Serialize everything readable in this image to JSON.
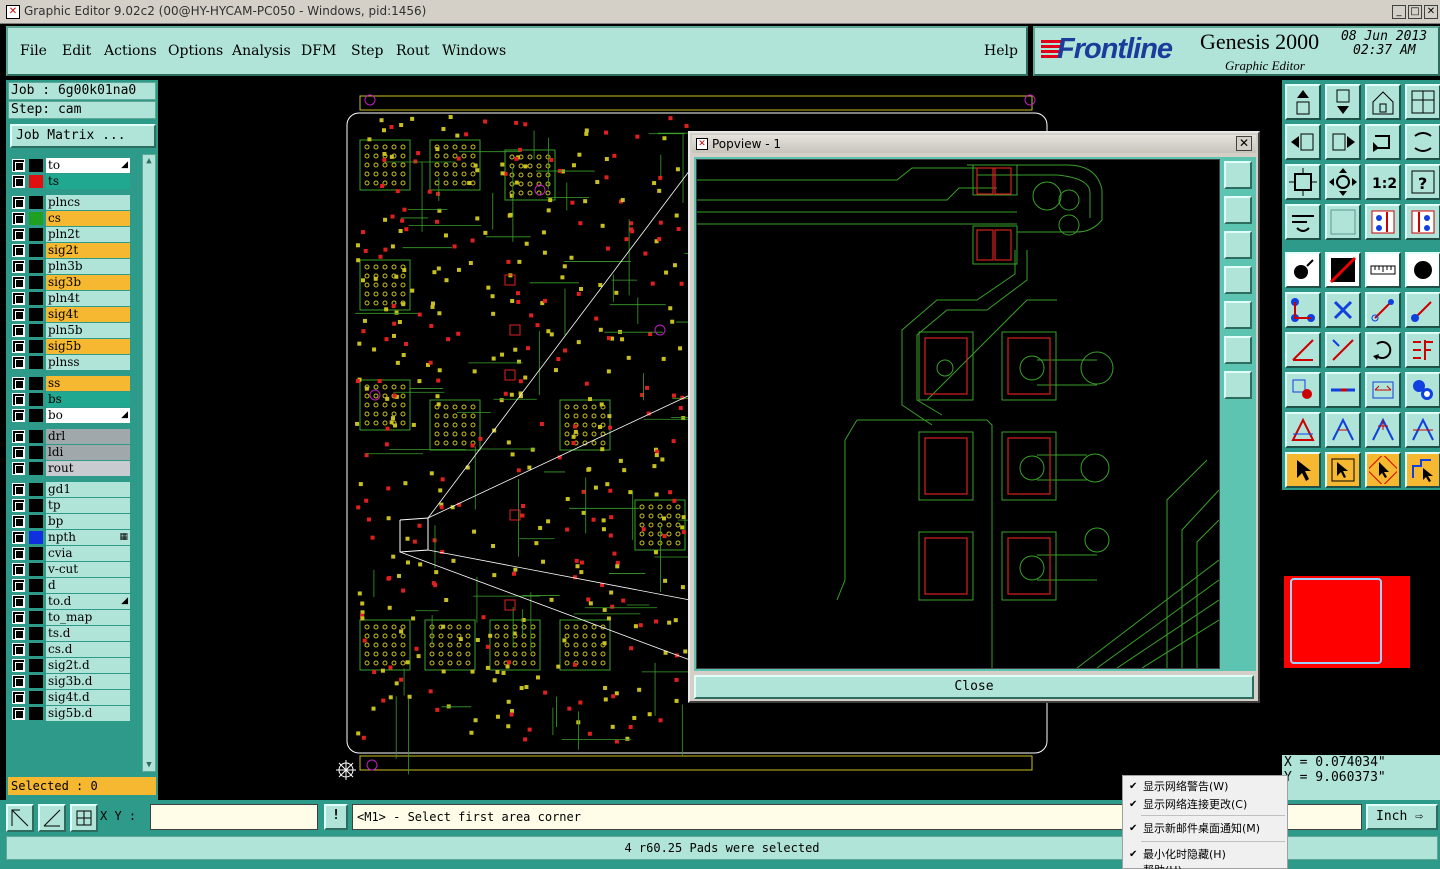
{
  "window": {
    "title": "Graphic Editor 9.02c2 (00@HY-HYCAM-PC050 - Windows, pid:1456)",
    "controls": [
      "_",
      "□",
      "✕"
    ]
  },
  "menu": [
    "File",
    "Edit",
    "Actions",
    "Options",
    "Analysis",
    "DFM",
    "Step",
    "Rout",
    "Windows"
  ],
  "help": "Help",
  "brand": {
    "logo": "Frontline",
    "product": "Genesis 2000",
    "subtitle": "Graphic Editor",
    "date": "08 Jun 2013",
    "time": "02:37 AM"
  },
  "job": {
    "job_label": "Job : 6g00k01na0",
    "step_label": "Step: cam",
    "matrix_button": "Job Matrix ..."
  },
  "layers": [
    {
      "name": "to",
      "color": "#ffffff",
      "swatch": "",
      "flag": "◢"
    },
    {
      "name": "ts",
      "color": "#20a890",
      "swatch": "#e01010",
      "flag": ""
    },
    {
      "name": "plncs",
      "color": "#b0e4d8",
      "swatch": "",
      "flag": ""
    },
    {
      "name": "cs",
      "color": "#f5b830",
      "swatch": "#20a020",
      "flag": ""
    },
    {
      "name": "pln2t",
      "color": "#b0e4d8",
      "swatch": "",
      "flag": ""
    },
    {
      "name": "sig2t",
      "color": "#f5b830",
      "swatch": "",
      "flag": ""
    },
    {
      "name": "pln3b",
      "color": "#b0e4d8",
      "swatch": "",
      "flag": ""
    },
    {
      "name": "sig3b",
      "color": "#f5b830",
      "swatch": "",
      "flag": ""
    },
    {
      "name": "pln4t",
      "color": "#b0e4d8",
      "swatch": "",
      "flag": ""
    },
    {
      "name": "sig4t",
      "color": "#f5b830",
      "swatch": "",
      "flag": ""
    },
    {
      "name": "pln5b",
      "color": "#b0e4d8",
      "swatch": "",
      "flag": ""
    },
    {
      "name": "sig5b",
      "color": "#f5b830",
      "swatch": "",
      "flag": ""
    },
    {
      "name": "plnss",
      "color": "#b0e4d8",
      "swatch": "",
      "flag": ""
    },
    {
      "name": "ss",
      "color": "#f5b830",
      "swatch": "",
      "flag": ""
    },
    {
      "name": "bs",
      "color": "#20a890",
      "swatch": "",
      "flag": ""
    },
    {
      "name": "bo",
      "color": "#ffffff",
      "swatch": "",
      "flag": "◢"
    },
    {
      "name": "drl",
      "color": "#a0a8ac",
      "swatch": "",
      "flag": ""
    },
    {
      "name": "ldi",
      "color": "#a0a8ac",
      "swatch": "",
      "flag": ""
    },
    {
      "name": "rout",
      "color": "#c8ccd0",
      "swatch": "",
      "flag": ""
    },
    {
      "name": "gd1",
      "color": "#b0e4d8",
      "swatch": "",
      "flag": ""
    },
    {
      "name": "tp",
      "color": "#b0e4d8",
      "swatch": "",
      "flag": ""
    },
    {
      "name": "bp",
      "color": "#b0e4d8",
      "swatch": "",
      "flag": ""
    },
    {
      "name": "npth",
      "color": "#b0e4d8",
      "swatch": "#1030e0",
      "flag": "▦"
    },
    {
      "name": "cvia",
      "color": "#b0e4d8",
      "swatch": "",
      "flag": ""
    },
    {
      "name": "v-cut",
      "color": "#b0e4d8",
      "swatch": "",
      "flag": ""
    },
    {
      "name": "d",
      "color": "#b0e4d8",
      "swatch": "",
      "flag": ""
    },
    {
      "name": "to.d",
      "color": "#b0e4d8",
      "swatch": "",
      "flag": "◢"
    },
    {
      "name": "to_map",
      "color": "#b0e4d8",
      "swatch": "",
      "flag": ""
    },
    {
      "name": "ts.d",
      "color": "#b0e4d8",
      "swatch": "",
      "flag": ""
    },
    {
      "name": "cs.d",
      "color": "#b0e4d8",
      "swatch": "",
      "flag": ""
    },
    {
      "name": "sig2t.d",
      "color": "#b0e4d8",
      "swatch": "",
      "flag": ""
    },
    {
      "name": "sig3b.d",
      "color": "#b0e4d8",
      "swatch": "",
      "flag": ""
    },
    {
      "name": "sig4t.d",
      "color": "#b0e4d8",
      "swatch": "",
      "flag": ""
    },
    {
      "name": "sig5b.d",
      "color": "#b0e4d8",
      "swatch": "",
      "flag": ""
    }
  ],
  "selected": "Selected : 0",
  "popview": {
    "title": "Popview - 1",
    "close_label": "Close",
    "close_x": "✕"
  },
  "coords": {
    "x": "X = 0.074034\"",
    "y": "Y = 9.060373\""
  },
  "bottom": {
    "xy_label": "X Y :",
    "xy_value": "",
    "excl": "!",
    "prompt": "<M1> - Select first area corner",
    "units": "Inch ⇨",
    "status": "4 r60.25 Pads were selected"
  },
  "context_menu": [
    {
      "label": "显示网络警告(W)",
      "checked": true
    },
    {
      "label": "显示网络连接更改(C)",
      "checked": true
    },
    {
      "label": "显示新邮件桌面通知(M)",
      "checked": true
    },
    {
      "label": "最小化时隐藏(H)",
      "checked": true
    },
    {
      "label": "帮助(H)",
      "checked": false
    }
  ],
  "icons": {
    "toolbox": [
      "pan-up-icon",
      "pan-down-icon",
      "home-icon",
      "window-icon",
      "pan-left-icon",
      "pan-right-icon",
      "zoom-back-icon",
      "redraw-icon",
      "fit-icon",
      "center-icon",
      "one-to-one-icon",
      "help-icon",
      "measure-icon",
      "grid-icon",
      "snap-icon",
      "snap-net-icon",
      "pad-icon",
      "slash-icon",
      "ruler-icon",
      "dot-icon",
      "net-icon",
      "delete-icon",
      "move-icon",
      "copy-icon",
      "line-icon",
      "edit-line-icon",
      "arc-icon",
      "align-icon",
      "attr-icon",
      "split-icon",
      "resize-icon",
      "group-icon",
      "triangle-icon",
      "peak-icon",
      "peak2-icon",
      "peak3-icon",
      "pointer-icon",
      "select-icon",
      "select2-icon",
      "route-icon"
    ]
  }
}
